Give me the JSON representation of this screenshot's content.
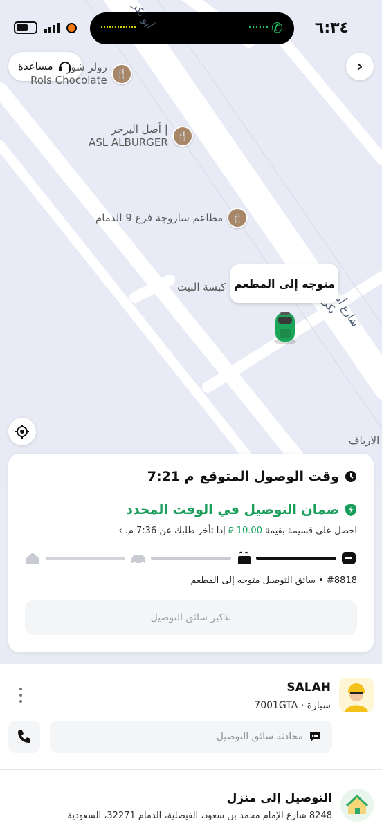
{
  "status_bar": {
    "time": "٦:٣٤"
  },
  "map": {
    "help_label": "مساعدة",
    "pois": [
      {
        "name_ar": "رولز شو",
        "name_en": "Rols Chocolate"
      },
      {
        "name_ar": "أصل البرجر |",
        "name_en": "ASL ALBURGER"
      },
      {
        "name_ar": "مطاعم ساروجة فرع 9 الدمام"
      }
    ],
    "labels": {
      "kabsa": "كبسة البيت",
      "aryaf": "الارياف",
      "street_top": "أبو بكر",
      "street_right": "شارع أبو بكر"
    },
    "bubble": "متوجه إلى المطعم"
  },
  "status_card": {
    "eta_label": "وقت الوصول المتوقع",
    "eta_time": "7:21 م",
    "guarantee_title": "ضمان التوصيل في الوقت المحدد",
    "guarantee_pre": "احصل على قسيمة بقيمة",
    "guarantee_amount": "10.00",
    "guarantee_post": "إذا تأخر طلبك عن 7:36 م. ›",
    "order_line": "#8818 • سائق التوصيل متوجه إلى المطعم",
    "progress_step": 1,
    "progress_total": 3,
    "remind_button": "تذكير سائق التوصيل"
  },
  "driver": {
    "name": "SALAH",
    "vehicle_type": "سيارة",
    "plate": "7001GTA",
    "chat_placeholder": "محادثة سائق التوصيل"
  },
  "destination": {
    "title": "التوصيل إلى منزل",
    "address": "8248 شارع الإمام محمد بن سعود، الفيصلية، الدمام 32271، السعودية"
  },
  "colors": {
    "accent_green": "#1a9e5c",
    "car_green": "#1aa55a",
    "poi_brown": "#a78768"
  }
}
